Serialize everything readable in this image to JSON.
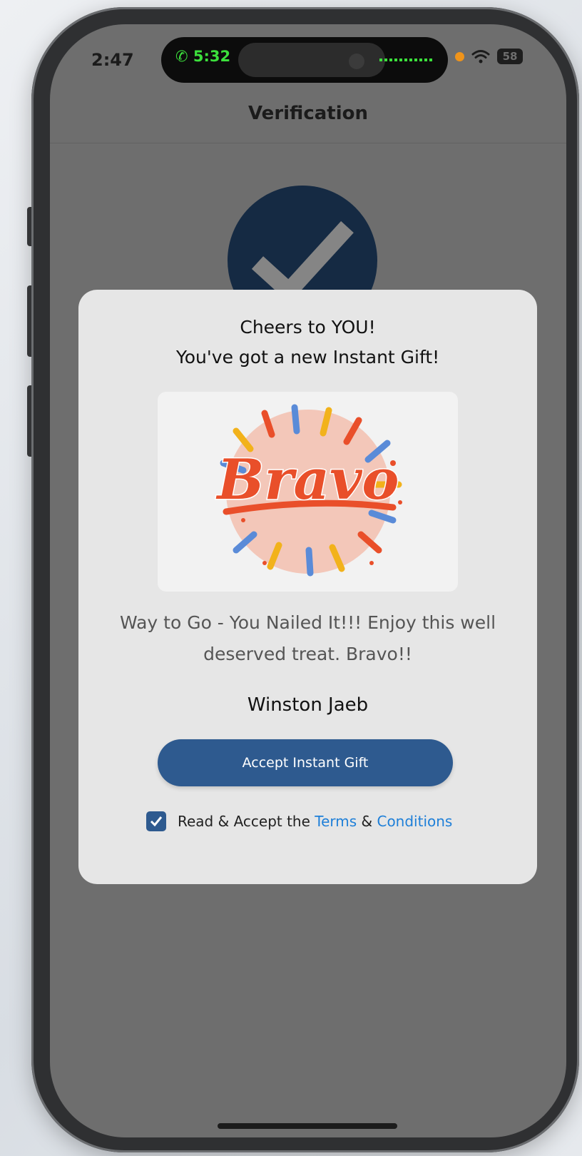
{
  "status_bar": {
    "time": "2:47",
    "call_timer": "5:32",
    "battery": "58"
  },
  "nav": {
    "title": "Verification"
  },
  "modal": {
    "title_line1": "Cheers to YOU!",
    "title_line2": "You've got a new Instant Gift!",
    "gift_image_text": "Bravo",
    "message": "Way to Go - You Nailed It!!! Enjoy this well deserved treat. Bravo!!",
    "sender": "Winston Jaeb",
    "accept_button": "Accept Instant Gift",
    "terms": {
      "checked": true,
      "prefix": "Read & Accept the ",
      "terms_link": "Terms",
      "joiner": " & ",
      "conditions_link": "Conditions"
    }
  },
  "colors": {
    "accent": "#2e5a8f",
    "link": "#1e7fd8",
    "check_circle": "#152a43",
    "overlay": "#6e6e6e"
  }
}
